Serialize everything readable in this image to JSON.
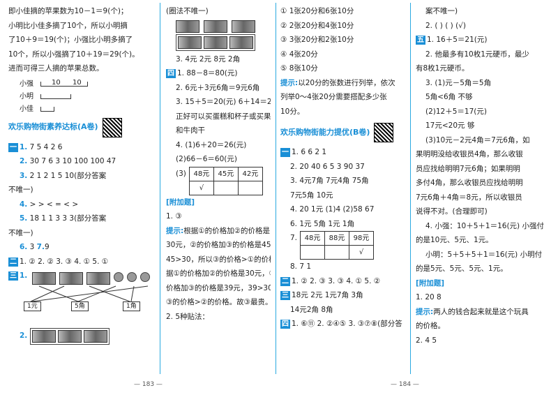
{
  "col1": {
    "lines": [
      "即小佳摘的苹果数为10－1＝9(个)；",
      "小明比小佳多摘了10个，所以小明摘",
      "了10＋9＝19(个)；小强比小明多摘了",
      "10个，所以小强摘了10＋19＝29(个)。",
      "进而可得三人摘的苹果总数。"
    ],
    "diagram": {
      "label_a": "小强",
      "label_b": "小明",
      "label_c": "小佳",
      "num1": "10",
      "num2": "10"
    },
    "section_title": "欢乐购物街素养达标(A卷)",
    "q1_badge": "一",
    "q1": [
      {
        "n": "1.",
        "t": "7  5  4  2  6"
      },
      {
        "n": "2.",
        "t": "30  7  6  3  10  100  100  47"
      },
      {
        "n": "3.",
        "t": "2  1  2  1  5  10(部分答案"
      },
      {
        "n": "",
        "t": "不唯一)"
      },
      {
        "n": "4.",
        "t": ">  >  <  =  <  >"
      },
      {
        "n": "5.",
        "t": "18  1  1  3  3  3(部分答案"
      },
      {
        "n": "",
        "t": "不唯一)"
      },
      {
        "n": "6.",
        "t": "3  ",
        "n2": "7.",
        "t2": "9"
      }
    ],
    "q2_badge": "二",
    "q2": "1. ②  2. ②  3. ③  4. ①  5. ①",
    "q3_badge": "三",
    "q3_n1": "1.",
    "match_tags": [
      "1元",
      "5角",
      "1角"
    ],
    "q3_n2": "2."
  },
  "col2": {
    "top": "(圈法不唯一)",
    "q3": "3. 4元  2元  8元  2角",
    "q4_badge": "四",
    "q4_lines": [
      "1. 88－8＝80(元)",
      "2. 6元＋3元6角＝9元6角",
      "3. 15＋5＝20(元)  6＋14＝20(元)",
      "正好可以买蛋糕和杯子或买果冻",
      "和牛肉干",
      "4. (1)6＋20＝26(元)",
      "(2)66－6＝60(元)",
      "(3)"
    ],
    "table": [
      "48元",
      "45元",
      "42元",
      "√",
      "",
      ""
    ],
    "extra_title": "[附加题]",
    "extra_1": "1. ③",
    "tip_label": "提示:",
    "tip_lines": [
      "根据①的价格加②的价格是",
      "30元，②的价格加③的价格是45元，",
      "45>30，所以③的价格>①的价格；根",
      "据①的价格加②的价格是30元，①的",
      "价格加③的价格是39元，39>30，所以",
      "③的价格>②的价格。故③最贵。"
    ],
    "extra_2": "2. 5种贴法："
  },
  "col3": {
    "top_lines": [
      "① 1张20分和6张10分",
      "② 2张20分和4张10分",
      "③ 3张20分和2张10分",
      "④ 4张20分",
      "⑤ 8张10分"
    ],
    "tip_label": "提示:",
    "tip_lines": [
      "以20分的张数进行列举，依次",
      "列举0～4张20分需要搭配多少张",
      "10分。"
    ],
    "section_title": "欢乐购物街能力提优(B卷)",
    "q1_badge": "一",
    "q1": [
      "1. 6  6  2  1",
      "2. 20  40  6  5  3  90  37",
      "3. 4元7角  7元4角  75角",
      "7元5角  10元",
      "4. 20  1元  (1)4  (2)58  67",
      "6. 1元  5角  1元  1角",
      "7."
    ],
    "table": [
      "48元",
      "88元",
      "98元",
      "",
      "",
      "√"
    ],
    "q8": "8. 7  1",
    "q2_badge": "二",
    "q2": "1. ②  2. ③  3. ③  4. ①  5. ②",
    "q3_badge": "三",
    "q3_lines": [
      "18元  2元  1元7角  3角",
      "14元2角  8角"
    ],
    "q4_badge": "四",
    "q4": "1. ⑥⑪  2. ②④⑤  3. ③⑦⑧(部分答"
  },
  "col4": {
    "lines_top": [
      "案不唯一)",
      "2. (  ) (  ) (√)"
    ],
    "q5_badge": "五",
    "q5_lines": [
      "1. 16＋5＝21(元)",
      "2. 他最多有10枚1元硬币，最少",
      "有8枚1元硬币。",
      "3. (1)元－5角＝5角",
      "5角<6角  不够",
      "(2)12＋5＝17(元)",
      "17元<20元  够",
      "(3)10元－2元4角＝7元6角，如",
      "果明明没给收银员4角，那么收银",
      "员应找给明明7元6角；如果明明",
      "多付4角，那么收银员应找给明明",
      "7元6角＋4角＝8元，所以收银员",
      "说得不对。(合理即可)",
      "4. 小强：10＋5＋1＝16(元)  小强付",
      "的是10元、5元、1元。",
      "小明：5＋5＋5＋1＝16(元)  小明付",
      "的是5元、5元、5元、1元。"
    ],
    "extra_title": "[附加题]",
    "extra_1": "1. 20  8",
    "tip_label": "提示:",
    "tip_lines": [
      "两人的钱合起来就是这个玩具",
      "的价格。"
    ],
    "extra_2": "2. 4  5"
  },
  "footer": {
    "left_page": "— 183 —",
    "right_page": "— 184 —"
  }
}
